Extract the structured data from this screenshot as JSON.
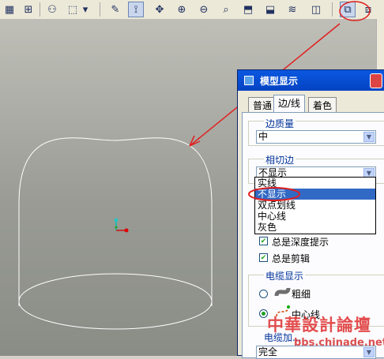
{
  "toolbar": {
    "icons": [
      "grid-icon",
      "binoculars-icon",
      "select-box-icon",
      "dropdown-arrow-icon",
      "sketch-icon",
      "datum-axes-icon",
      "spin-icon",
      "zoom-in-icon",
      "zoom-out-icon",
      "fit-icon",
      "orient-icon",
      "view-manager-icon",
      "layers-icon",
      "camera-icon",
      "wireframe-icon",
      "shading-icon"
    ]
  },
  "dialog": {
    "title": "模型显示",
    "tabs": [
      "普通",
      "边/线",
      "着色"
    ],
    "active_tab": "边/线",
    "edge_quality": {
      "label": "边质量",
      "value": "中"
    },
    "tangent_edges": {
      "label": "相切边",
      "value": "不显示",
      "options": [
        "实线",
        "不显示",
        "双点划线",
        "中心线",
        "灰色"
      ],
      "highlighted": "不显示"
    },
    "checkboxes": [
      {
        "label": "总是深度提示",
        "checked": true
      },
      {
        "label": "总是剪辑",
        "checked": true
      }
    ],
    "cable_display": {
      "label": "电缆显示",
      "options": [
        {
          "label": "粗细",
          "selected": false
        },
        {
          "label": "中心线",
          "selected": true
        }
      ]
    },
    "cable_section": {
      "label": "电缆加...",
      "value": "完全"
    }
  },
  "watermark": {
    "line1": "中華設計論壇",
    "line2": "bbs.chinade.net"
  },
  "colors": {
    "annotation": "#e02020",
    "title_bar": "#0a58e0",
    "selection": "#316ac5"
  }
}
